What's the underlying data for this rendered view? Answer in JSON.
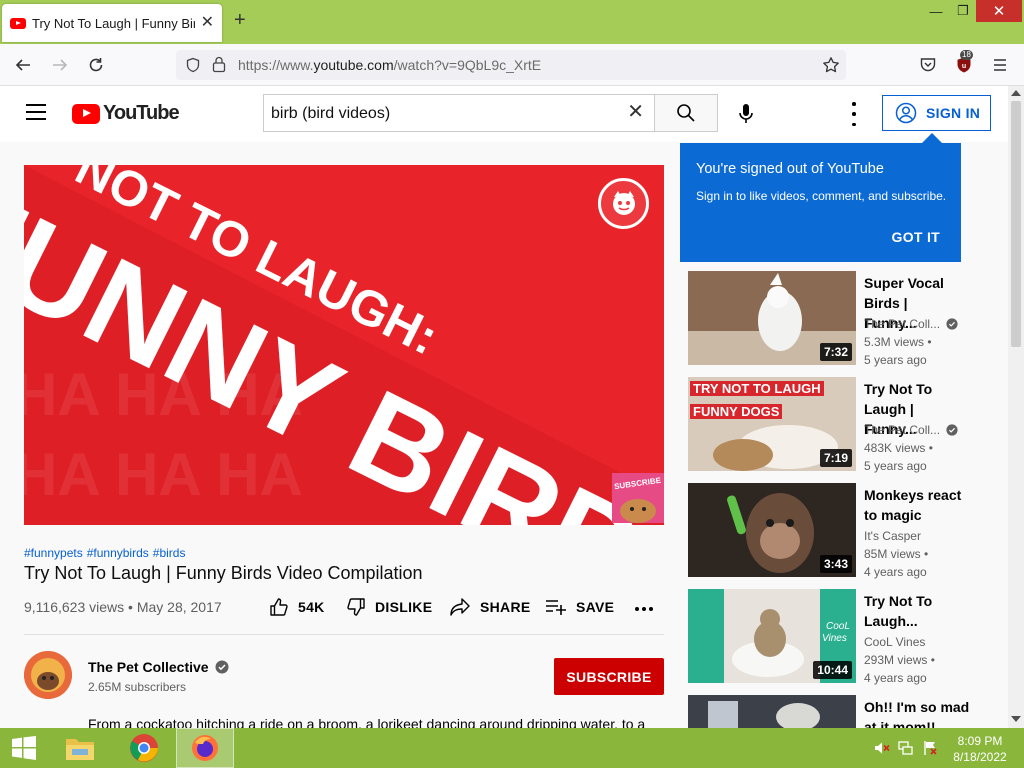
{
  "browser": {
    "tab_title": "Try Not To Laugh | Funny Birds",
    "tab_close": "✕",
    "new_tab": "+",
    "url_prefix": "https://www.",
    "url_domain": "youtube.com",
    "url_path": "/watch?v=9QbL9c_XrtE",
    "extension_badge": "18",
    "window_controls": {
      "minimize": "—",
      "maximize": "❐",
      "close": "✕"
    }
  },
  "youtube": {
    "logo_text": "YouTube",
    "search_value": "birb (bird videos)",
    "search_clear": "✕",
    "signin_label": "SIGN IN",
    "popup": {
      "title": "You're signed out of YouTube",
      "description": "Sign in to like videos, comment, and subscribe.",
      "button": "GOT IT"
    }
  },
  "video": {
    "hashtags": [
      "#funnypets",
      "#funnybirds",
      "#birds"
    ],
    "title": "Try Not To Laugh | Funny Birds Video Compilation",
    "views": "9,116,623 views",
    "date": "May 28, 2017",
    "meta_sep": " • ",
    "likes": "54K",
    "dislike_label": "DISLIKE",
    "share_label": "SHARE",
    "save_label": "SAVE",
    "thumbnail_text": {
      "line1": "NOT TO LAUGH:",
      "line2": "FUNNY BIRD",
      "logo": "THE PET COLLECTIVE",
      "corner": "SUBSCRIBE"
    }
  },
  "channel": {
    "name": "The Pet Collective",
    "subscribers": "2.65M subscribers",
    "subscribe_label": "SUBSCRIBE",
    "description": "From a cockatoo hitching a ride on a broom, a lorikeet dancing around dripping water, to a"
  },
  "recommendations": [
    {
      "title": "Super Vocal Birds | Funny...",
      "channel": "The Pet Coll...",
      "verified": true,
      "views": "5.3M views •",
      "age": "5 years ago",
      "duration": "7:32",
      "thumb_color": "#8a6a52"
    },
    {
      "title": "Try Not To Laugh | Funny...",
      "channel": "The Pet Coll...",
      "verified": true,
      "views": "483K views •",
      "age": "5 years ago",
      "duration": "7:19",
      "thumb_color": "#d9cbbb",
      "thumb_text": [
        "TRY NOT TO LAUGH",
        "FUNNY DOGS"
      ]
    },
    {
      "title": "Monkeys react to magic",
      "channel": "It's Casper",
      "verified": false,
      "views": "85M views •",
      "age": "4 years ago",
      "duration": "3:43",
      "thumb_color": "#5b4637"
    },
    {
      "title": "Try Not To Laugh...",
      "channel": "CooL Vines",
      "verified": false,
      "views": "293M views •",
      "age": "4 years ago",
      "duration": "10:44",
      "thumb_color": "#2bb08f",
      "thumb_text": [
        "CooL",
        "Vines"
      ]
    },
    {
      "title": "Oh!! I'm so mad at it mom!!",
      "channel": "",
      "verified": false,
      "views": "",
      "age": "",
      "duration": "",
      "thumb_color": "#3c4048"
    }
  ],
  "taskbar": {
    "time": "8:09 PM",
    "date": "8/18/2022"
  },
  "colors": {
    "tabbar": "#a4cc56",
    "taskbar": "#8ab63c",
    "youtube_red": "#ff0000",
    "link_blue": "#065fd4",
    "popup_blue": "#0c6ad5",
    "subscribe_red": "#cc0000"
  }
}
